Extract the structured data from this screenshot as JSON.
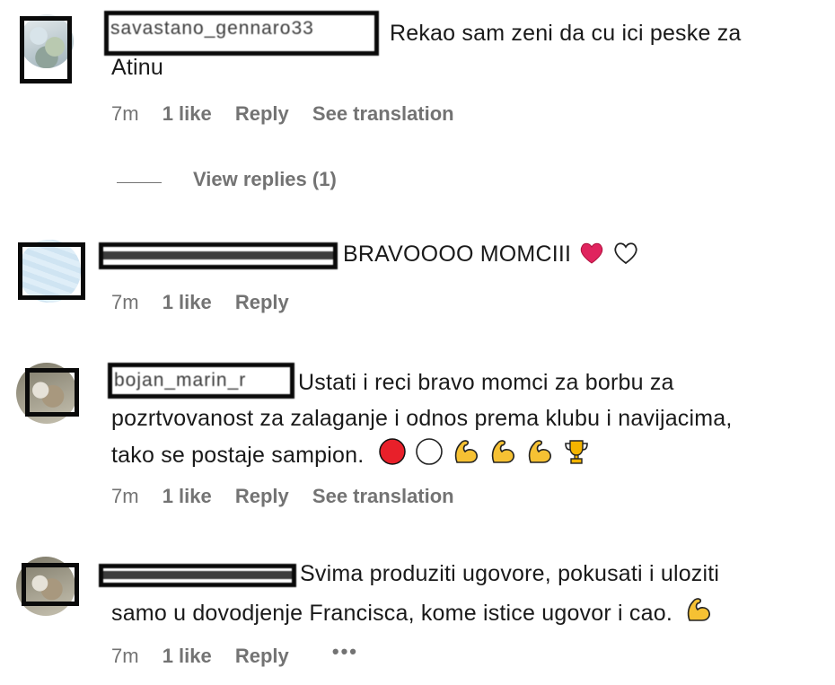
{
  "comments": [
    {
      "username": "savastano_gennaro33",
      "text_line1": "Rekao sam zeni da cu ici peske za",
      "text_line2": "Atinu",
      "time": "7m",
      "likes": "1 like",
      "reply": "Reply",
      "translation": "See translation",
      "view_replies": "View replies (1)"
    },
    {
      "username": "",
      "text": "BRAVOOOO MOMCIII",
      "time": "7m",
      "likes": "1 like",
      "reply": "Reply"
    },
    {
      "username": "bojan_marin_r",
      "text_line1": "Ustati i reci bravo momci za borbu za",
      "text_line2": "pozrtvovanost za zalaganje i odnos prema klubu i navijacima,",
      "text_line3": "tako se postaje sampion.",
      "time": "7m",
      "likes": "1 like",
      "reply": "Reply",
      "translation": "See translation"
    },
    {
      "username": "",
      "text_line1": "Svima produziti ugovore, pokusati i uloziti",
      "text_line2": "samo u dovodjenje Francisca, kome istice ugovor i cao.",
      "time": "7m",
      "likes": "1 like",
      "reply": "Reply",
      "more": "•••"
    }
  ],
  "icons": {
    "red_heart": "red-heart-icon",
    "white_heart": "white-heart-icon",
    "red_circle": "red-circle-icon",
    "white_circle": "white-circle-icon",
    "flexed_biceps": "flexed-biceps-icon",
    "trophy": "trophy-icon"
  },
  "colors": {
    "meta_gray": "#737373",
    "text": "#1a1a1a",
    "heart_red": "#e0245e",
    "circle_red": "#e8202a",
    "biceps_yellow": "#f6c133",
    "trophy_gold": "#f4b400"
  }
}
